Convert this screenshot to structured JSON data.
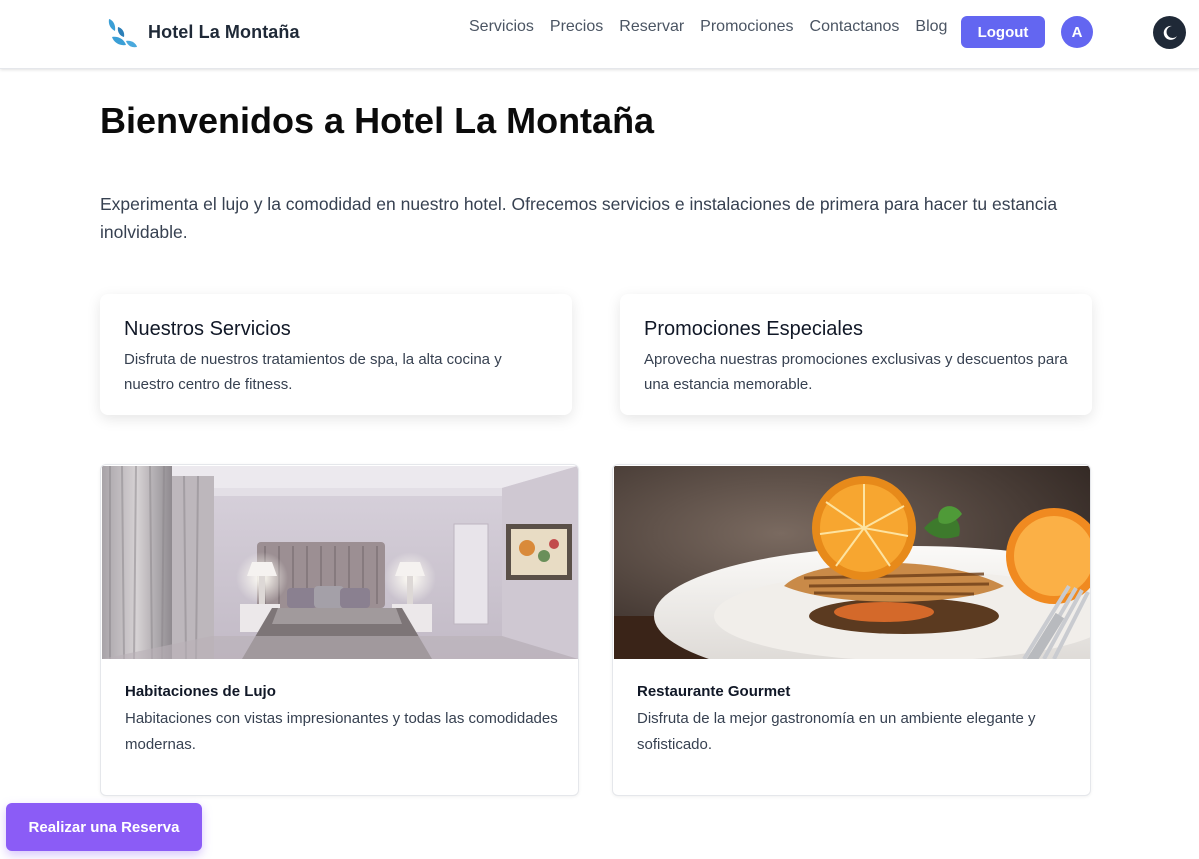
{
  "header": {
    "brand_name": "Hotel La Montaña",
    "nav": [
      "Servicios",
      "Precios",
      "Reservar",
      "Promociones",
      "Contactanos",
      "Blog"
    ],
    "logout_label": "Logout",
    "avatar_initial": "A",
    "brand_icon": "droplets-logo-icon",
    "theme_icon": "moon-icon"
  },
  "main": {
    "title": "Bienvenidos a Hotel La Montaña",
    "intro": "Experimenta el lujo y la comodidad en nuestro hotel. Ofrecemos servicios e instalaciones de primera para hacer tu estancia inolvidable.",
    "info_cards": [
      {
        "title": "Nuestros Servicios",
        "text": "Disfruta de nuestros tratamientos de spa, la alta cocina y nuestro centro de fitness."
      },
      {
        "title": "Promociones Especiales",
        "text": "Aprovecha nuestras promociones exclusivas y descuentos para una estancia memorable."
      }
    ],
    "feature_cards": [
      {
        "title": "Habitaciones de Lujo",
        "text": "Habitaciones con vistas impresionantes y todas las comodidades modernas.",
        "image": "hotel-bedroom-photo"
      },
      {
        "title": "Restaurante Gourmet",
        "text": "Disfruta de la mejor gastronomía en un ambiente elegante y sofisticado.",
        "image": "gourmet-dish-photo"
      }
    ]
  },
  "cta": {
    "reserve_label": "Realizar una Reserva"
  },
  "colors": {
    "primary": "#6366f1",
    "cta": "#8b5cf6",
    "dark_toggle": "#1f2937"
  }
}
